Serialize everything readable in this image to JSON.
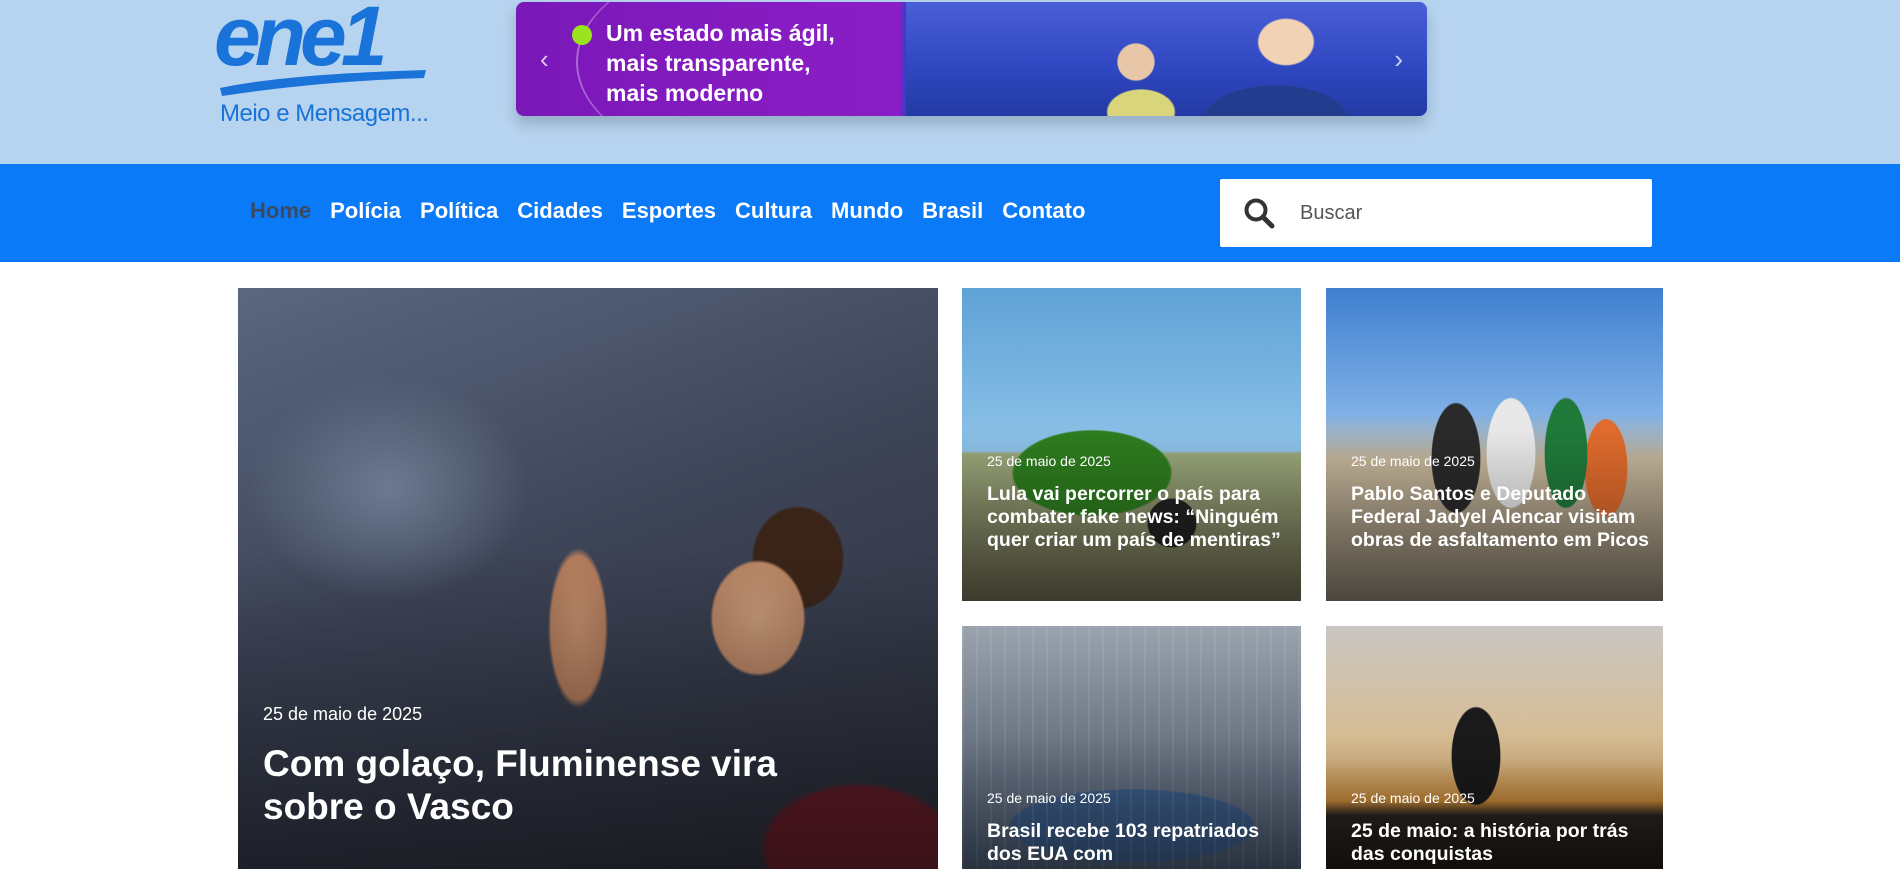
{
  "brand": {
    "logo_word": "ene1",
    "tagline": "Meio e Mensagem...",
    "colors": {
      "primary": "#0a7af8",
      "header_bg": "#b6d3ef",
      "logo": "#1a73d9"
    }
  },
  "banner": {
    "lines": [
      "Um estado mais ágil,",
      "mais transparente,",
      "mais moderno"
    ],
    "prev_icon": "chevron-left-icon",
    "next_icon": "chevron-right-icon",
    "colors": {
      "dot": "#9be21f",
      "purple": "#8b1ec6"
    }
  },
  "nav": {
    "items": [
      {
        "label": "Home",
        "active": true
      },
      {
        "label": "Polícia"
      },
      {
        "label": "Política"
      },
      {
        "label": "Cidades"
      },
      {
        "label": "Esportes"
      },
      {
        "label": "Cultura"
      },
      {
        "label": "Mundo"
      },
      {
        "label": "Brasil"
      },
      {
        "label": "Contato"
      }
    ],
    "search": {
      "placeholder": "Buscar",
      "icon": "search-icon"
    }
  },
  "articles": {
    "main": {
      "date": "25 de maio de 2025",
      "title": "Com golaço, Fluminense vira sobre o Vasco"
    },
    "side": [
      {
        "date": "25 de maio de 2025",
        "title": "Lula vai percorrer o país para combater fake news: “Ninguém quer criar um país de mentiras”"
      },
      {
        "date": "25 de maio de 2025",
        "title": "Pablo Santos e Deputado Federal Jadyel Alencar visitam obras de asfaltamento em Picos"
      },
      {
        "date": "25 de maio de 2025",
        "title": "Brasil recebe 103 repatriados dos EUA com"
      },
      {
        "date": "25 de maio de 2025",
        "title": "25 de maio: a história por trás das conquistas"
      }
    ]
  }
}
